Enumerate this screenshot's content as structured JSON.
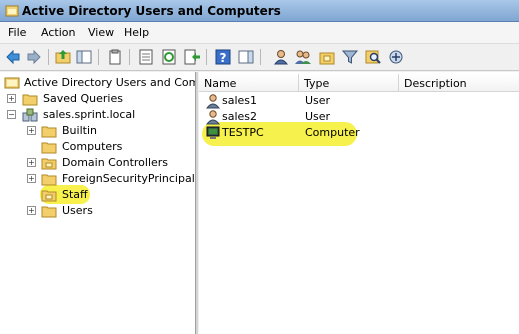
{
  "window": {
    "title": "Active Directory Users and Computers"
  },
  "menu": {
    "items": [
      "File",
      "Action",
      "View",
      "Help"
    ]
  },
  "toolbar": {
    "buttons": [
      "back-icon",
      "forward-icon",
      "up-folder-icon",
      "show-hide-console-tree-icon",
      "copy-icon",
      "properties-icon",
      "refresh-icon",
      "export-list-icon",
      "help-icon",
      "action-pane-icon",
      "new-user-icon",
      "new-group-icon",
      "new-ou-icon",
      "filter-icon",
      "find-icon",
      "add-to-group-icon"
    ]
  },
  "tree": {
    "root": {
      "label": "Active Directory Users and Comput"
    },
    "saved_queries": {
      "label": "Saved Queries"
    },
    "domain": {
      "label": "sales.sprint.local"
    },
    "children": [
      {
        "label": "Builtin",
        "expandable": true
      },
      {
        "label": "Computers",
        "expandable": false
      },
      {
        "label": "Domain Controllers",
        "expandable": true
      },
      {
        "label": "ForeignSecurityPrincipals",
        "expandable": true
      },
      {
        "label": "Staff",
        "expandable": false,
        "selected": true
      },
      {
        "label": "Users",
        "expandable": true
      }
    ]
  },
  "list": {
    "columns": [
      "Name",
      "Type",
      "Description"
    ],
    "rows": [
      {
        "name": "sales1",
        "type": "User",
        "icon": "user-icon"
      },
      {
        "name": "sales2",
        "type": "User",
        "icon": "user-icon"
      },
      {
        "name": "TESTPC",
        "type": "Computer",
        "icon": "computer-icon"
      }
    ]
  },
  "colors": {
    "highlight": "#f7f03a",
    "titlebar": "#a9c7e8"
  }
}
